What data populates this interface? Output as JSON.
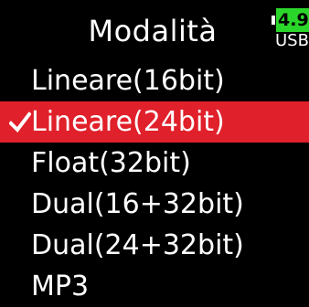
{
  "header": {
    "title": "Modalità",
    "battery": {
      "level_text": "4.9",
      "source_text": "USB",
      "level_color": "#2bd62b"
    }
  },
  "menu": {
    "items": [
      {
        "label": "Lineare(16bit)",
        "selected": false
      },
      {
        "label": "Lineare(24bit)",
        "selected": true
      },
      {
        "label": "Float(32bit)",
        "selected": false
      },
      {
        "label": "Dual(16+32bit)",
        "selected": false
      },
      {
        "label": "Dual(24+32bit)",
        "selected": false
      },
      {
        "label": "MP3",
        "selected": false
      }
    ],
    "selected_icon": "checkmark-icon"
  },
  "colors": {
    "background": "#000000",
    "text": "#ffffff",
    "highlight": "#e0202a",
    "battery": "#2bd62b"
  }
}
